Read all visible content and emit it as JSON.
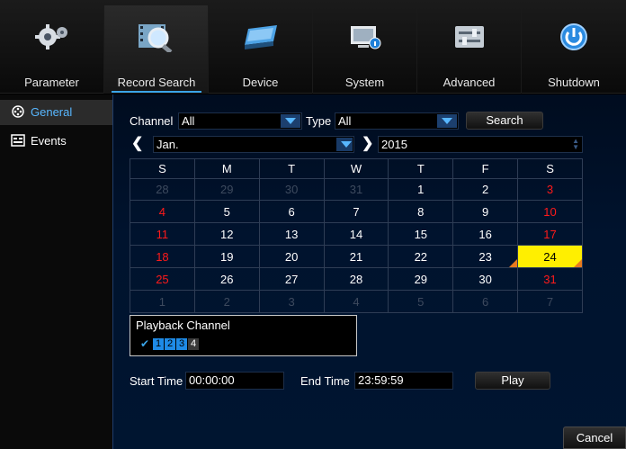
{
  "nav": {
    "tabs": [
      {
        "label": "Parameter",
        "icon": "gears-icon",
        "active": false
      },
      {
        "label": "Record Search",
        "icon": "film-search-icon",
        "active": true
      },
      {
        "label": "Device",
        "icon": "hard-drive-icon",
        "active": false
      },
      {
        "label": "System",
        "icon": "monitor-info-icon",
        "active": false
      },
      {
        "label": "Advanced",
        "icon": "sliders-icon",
        "active": false
      },
      {
        "label": "Shutdown",
        "icon": "power-icon",
        "active": false
      }
    ]
  },
  "sidebar": {
    "items": [
      {
        "label": "General",
        "icon": "film-reel-icon",
        "active": true
      },
      {
        "label": "Events",
        "icon": "event-list-icon",
        "active": false
      }
    ]
  },
  "search": {
    "channel_label": "Channel",
    "channel_value": "All",
    "type_label": "Type",
    "type_value": "All",
    "search_button": "Search",
    "month_value": "Jan.",
    "year_value": "2015"
  },
  "calendar": {
    "headers": [
      "S",
      "M",
      "T",
      "W",
      "T",
      "F",
      "S"
    ],
    "weeks": [
      [
        {
          "d": "28",
          "s": "other"
        },
        {
          "d": "29",
          "s": "other"
        },
        {
          "d": "30",
          "s": "other"
        },
        {
          "d": "31",
          "s": "other"
        },
        {
          "d": "1",
          "s": "cur"
        },
        {
          "d": "2",
          "s": "cur"
        },
        {
          "d": "3",
          "s": "wkend"
        }
      ],
      [
        {
          "d": "4",
          "s": "wkend"
        },
        {
          "d": "5",
          "s": "cur"
        },
        {
          "d": "6",
          "s": "cur"
        },
        {
          "d": "7",
          "s": "cur"
        },
        {
          "d": "8",
          "s": "cur"
        },
        {
          "d": "9",
          "s": "cur"
        },
        {
          "d": "10",
          "s": "wkend"
        }
      ],
      [
        {
          "d": "11",
          "s": "wkend"
        },
        {
          "d": "12",
          "s": "cur"
        },
        {
          "d": "13",
          "s": "cur"
        },
        {
          "d": "14",
          "s": "cur"
        },
        {
          "d": "15",
          "s": "cur"
        },
        {
          "d": "16",
          "s": "cur"
        },
        {
          "d": "17",
          "s": "wkend"
        }
      ],
      [
        {
          "d": "18",
          "s": "wkend"
        },
        {
          "d": "19",
          "s": "cur"
        },
        {
          "d": "20",
          "s": "cur"
        },
        {
          "d": "21",
          "s": "cur"
        },
        {
          "d": "22",
          "s": "cur"
        },
        {
          "d": "23",
          "s": "cur",
          "rec": true
        },
        {
          "d": "24",
          "s": "today",
          "rec": true
        }
      ],
      [
        {
          "d": "25",
          "s": "wkend"
        },
        {
          "d": "26",
          "s": "cur"
        },
        {
          "d": "27",
          "s": "cur"
        },
        {
          "d": "28",
          "s": "cur"
        },
        {
          "d": "29",
          "s": "cur"
        },
        {
          "d": "30",
          "s": "cur"
        },
        {
          "d": "31",
          "s": "wkend"
        }
      ],
      [
        {
          "d": "1",
          "s": "other"
        },
        {
          "d": "2",
          "s": "other"
        },
        {
          "d": "3",
          "s": "other"
        },
        {
          "d": "4",
          "s": "other"
        },
        {
          "d": "5",
          "s": "other"
        },
        {
          "d": "6",
          "s": "other"
        },
        {
          "d": "7",
          "s": "other"
        }
      ]
    ]
  },
  "playback": {
    "title": "Playback Channel",
    "all_checked": true,
    "channels": [
      {
        "label": "1",
        "checked": true
      },
      {
        "label": "2",
        "checked": true
      },
      {
        "label": "3",
        "checked": true
      },
      {
        "label": "4",
        "checked": false
      }
    ]
  },
  "time": {
    "start_label": "Start Time",
    "start_value": "00:00:00",
    "end_label": "End Time",
    "end_value": "23:59:59",
    "play_button": "Play"
  },
  "footer": {
    "cancel_button": "Cancel"
  },
  "colors": {
    "accent": "#3aa4e8",
    "weekend": "#ff1a1a",
    "today": "#ffef00",
    "record_marker": "#e87a1e",
    "checked_channel": "#1e8ae6"
  }
}
